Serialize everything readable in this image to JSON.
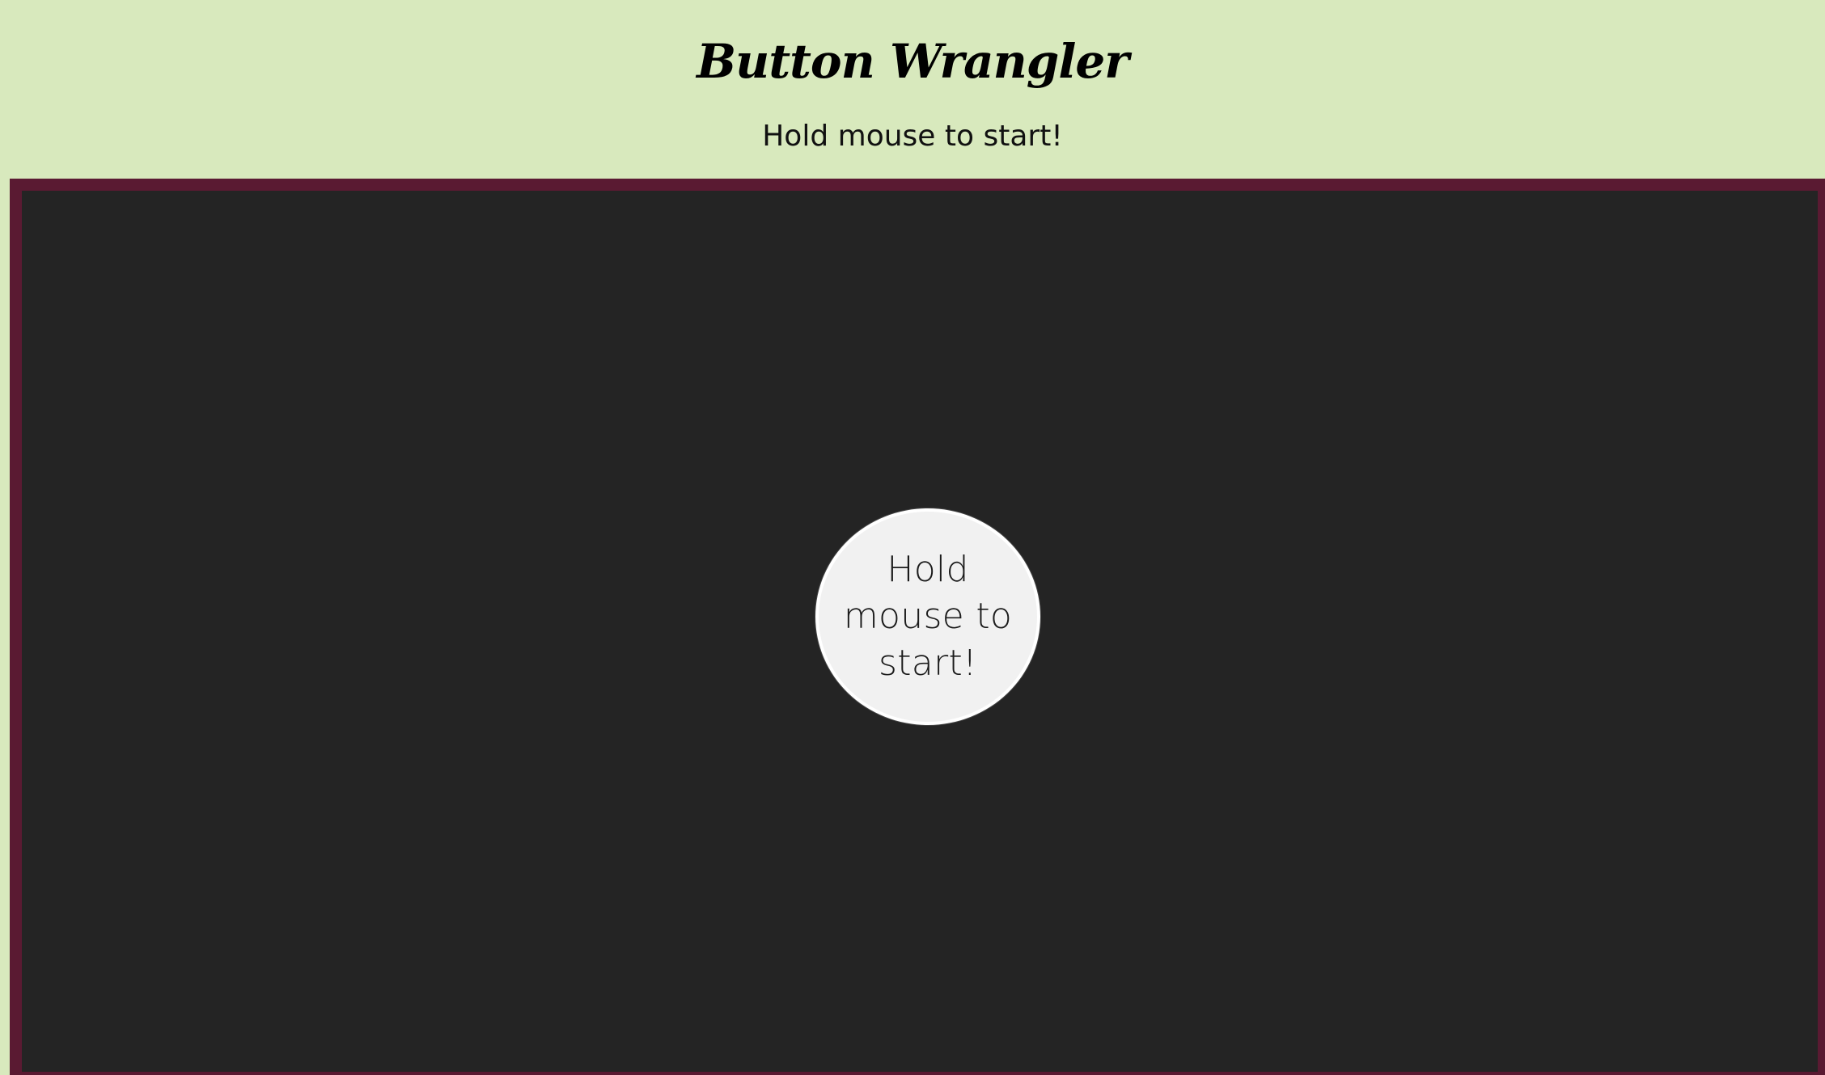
{
  "app": {
    "title": "Button Wrangler",
    "status_text": "Hold mouse to start!"
  },
  "game": {
    "button_label": "Hold mouse to start!"
  },
  "colors": {
    "page_background": "#d8e9bd",
    "arena_background": "#242424",
    "arena_border": "#5a1a32",
    "button_fill": "#f1f1f1",
    "button_outline": "#ffffff",
    "text": "#000000"
  }
}
